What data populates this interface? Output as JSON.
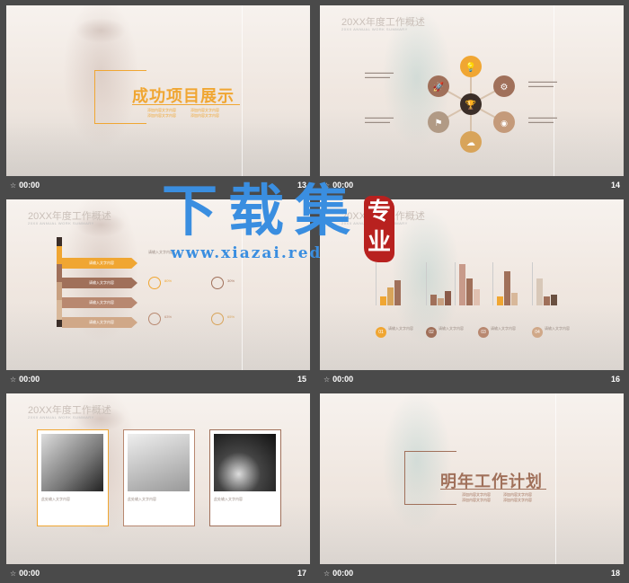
{
  "slides": [
    {
      "number": "13",
      "time": "00:00",
      "title": "成功项目展示",
      "subs": [
        "添加内容文字内容",
        "添加内容文字内容",
        "添加内容文字内容",
        "添加内容文字内容"
      ]
    },
    {
      "number": "14",
      "time": "00:00",
      "header_title": "20XX年度工作概述",
      "header_sub": "20XX ANNUAL WORK SUMMARY"
    },
    {
      "number": "15",
      "time": "00:00",
      "header_title": "20XX年度工作概述",
      "header_sub": "20XX ANNUAL WORK SUMMARY",
      "steps": [
        "请输入文字内容",
        "请输入文字内容",
        "请输入文字内容",
        "请输入文字内容"
      ],
      "stats": [
        "80%",
        "30%",
        "63%",
        "65%"
      ],
      "heading": "请输入文字内容"
    },
    {
      "number": "16",
      "time": "00:00",
      "header_title": "20XX年度工作概述",
      "header_sub": "20XX ANNUAL WORK SUMMARY",
      "labels": [
        "01",
        "02",
        "03",
        "04"
      ],
      "caption": "请输入文字内容"
    },
    {
      "number": "17",
      "time": "00:00",
      "header_title": "20XX年度工作概述",
      "header_sub": "20XX ANNUAL WORK SUMMARY",
      "caption": "此处输入文字内容"
    },
    {
      "number": "18",
      "time": "00:00",
      "title": "明年工作计划",
      "subs": [
        "添加内容文字内容",
        "添加内容文字内容",
        "添加内容文字内容",
        "添加内容文字内容"
      ]
    }
  ],
  "watermark": {
    "main": "下载集",
    "seal": "专业",
    "url": "www.xiazai.red"
  },
  "colors": {
    "orange": "#f0a632",
    "brown": "#a0705a",
    "tan": "#c8a080",
    "blue_watermark": "#3a8ee0",
    "seal_red": "#b8211f"
  }
}
